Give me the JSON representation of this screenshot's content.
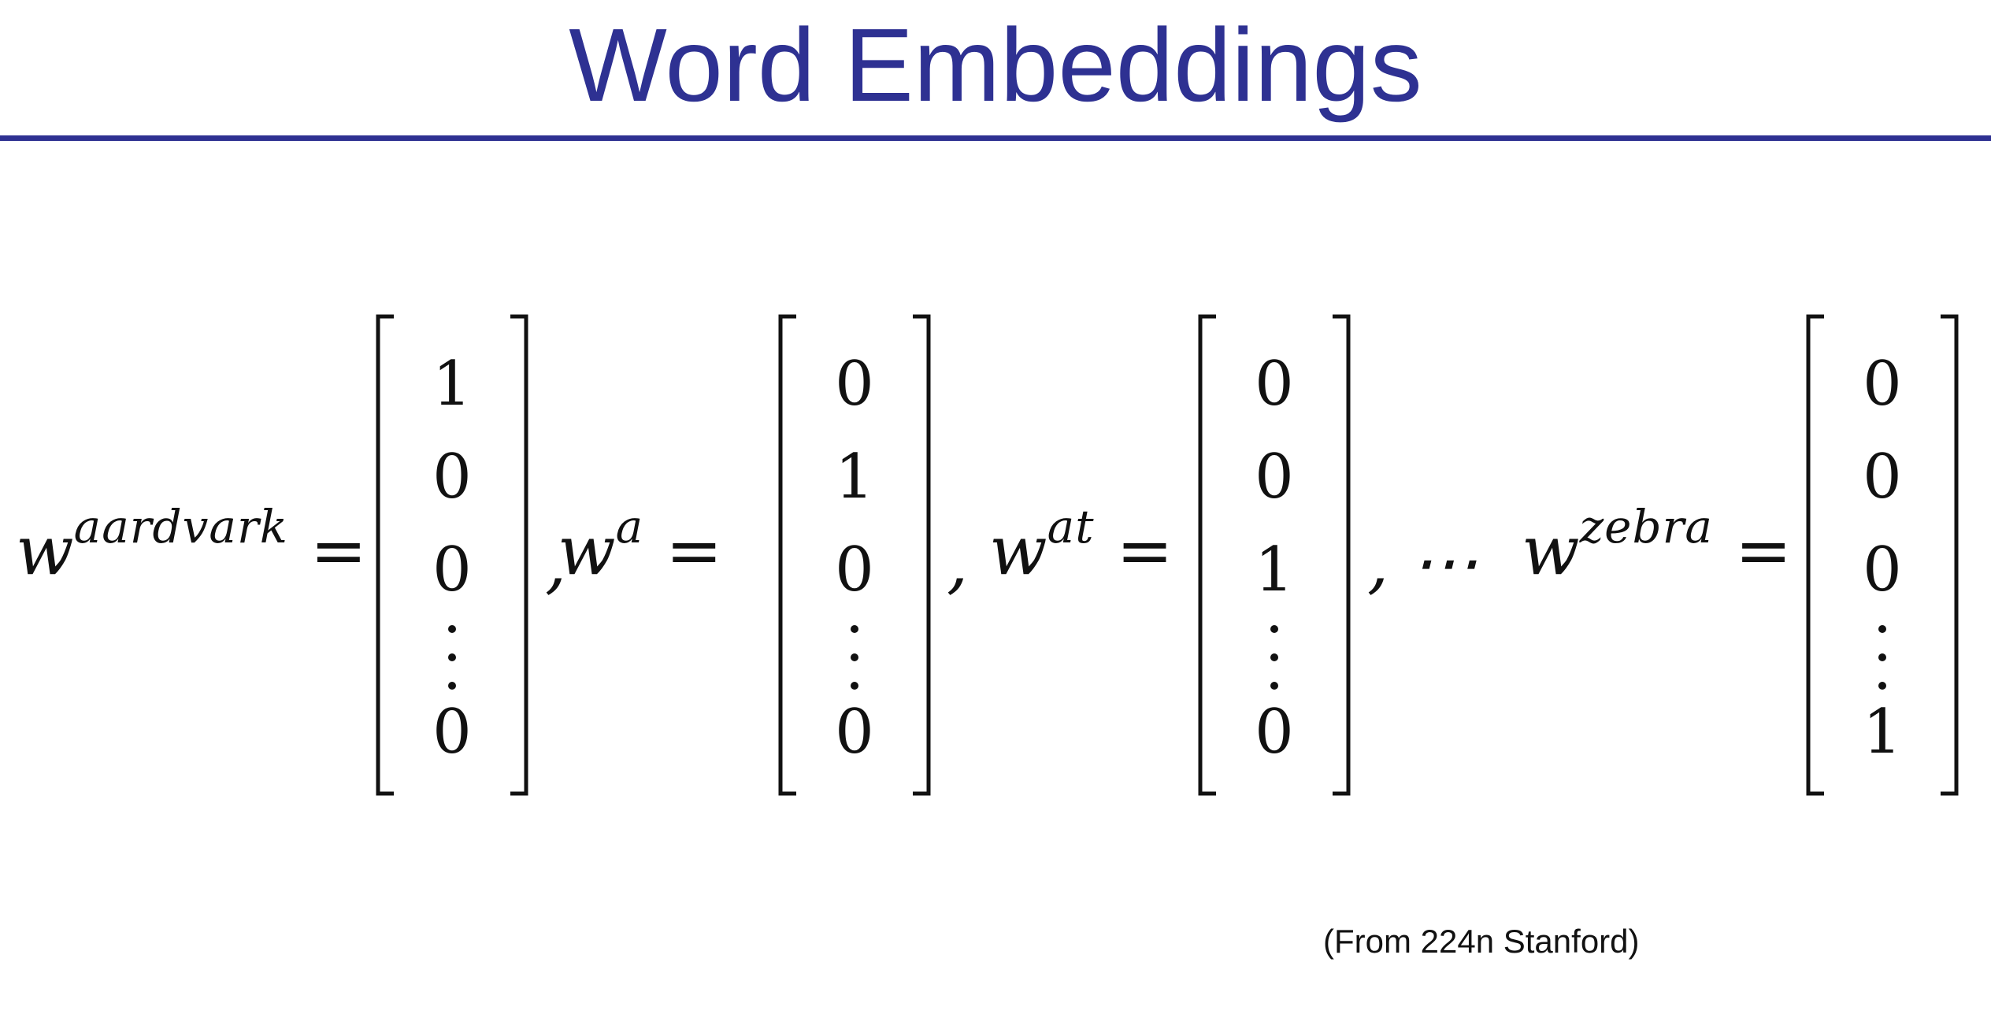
{
  "title": "Word Embeddings",
  "colors": {
    "title": "#2E3192",
    "rule": "#2E3192",
    "text": "#111111"
  },
  "equation": {
    "symbol": "w",
    "equals": "=",
    "separators": [
      ",",
      ",",
      ", ⋯"
    ],
    "vectors": [
      {
        "word": "aardvark",
        "entries": [
          "1",
          "0",
          "0",
          "0"
        ]
      },
      {
        "word": "a",
        "entries": [
          "0",
          "1",
          "0",
          "0"
        ]
      },
      {
        "word": "at",
        "entries": [
          "0",
          "0",
          "1",
          "0"
        ]
      },
      {
        "word": "zebra",
        "entries": [
          "0",
          "0",
          "0",
          "1"
        ]
      }
    ]
  },
  "credit": "(From 224n Stanford)"
}
